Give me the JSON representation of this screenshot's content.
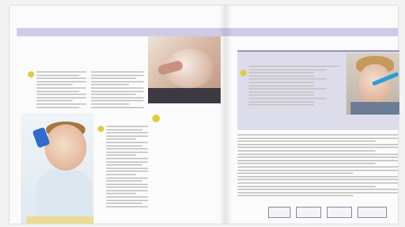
{
  "spread": {
    "left_header": "",
    "right_header": "",
    "left_heading": "",
    "section_heading": "",
    "pull_quote": "",
    "box_title": ""
  },
  "colors": {
    "accent_band": "#cfcbe6",
    "bullet_yellow": "#e5c938",
    "box_tint": "#dcdcea"
  }
}
